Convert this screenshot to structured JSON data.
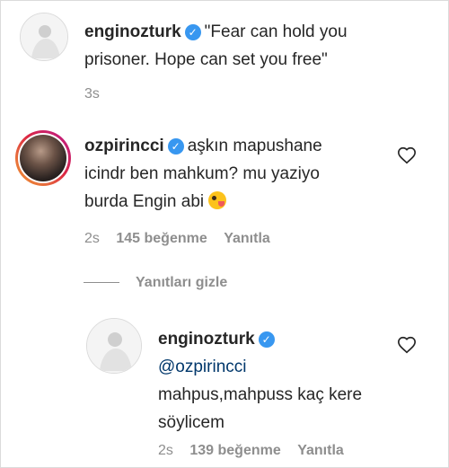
{
  "comments": [
    {
      "username": "enginozturk",
      "verified": true,
      "text_line1": "\"Fear can hold you",
      "text_line2": "prisoner. Hope can set you free\"",
      "time": "3s"
    },
    {
      "username": "ozpirincci",
      "verified": true,
      "text_line1": "aşkın mapushane",
      "text_line2": "icindr ben mahkum? mu yaziyo",
      "text_line3": "burda Engin abi",
      "emoji": "zany-face-emoji",
      "time": "2s",
      "likes": "145 beğenme",
      "reply_label": "Yanıtla"
    }
  ],
  "replies_toggle": "Yanıtları gizle",
  "reply": {
    "username": "enginozturk",
    "verified": true,
    "mention": "@ozpirincci",
    "text_line1": "mahpus,mahpuss kaç kere",
    "text_line2": "söylicem",
    "time": "2s",
    "likes": "139 beğenme",
    "reply_label": "Yanıtla"
  },
  "colors": {
    "verified": "#3897f0",
    "secondary_text": "#8e8e8e",
    "mention": "#00376b"
  },
  "icons": [
    "verified-badge-icon",
    "heart-icon"
  ]
}
